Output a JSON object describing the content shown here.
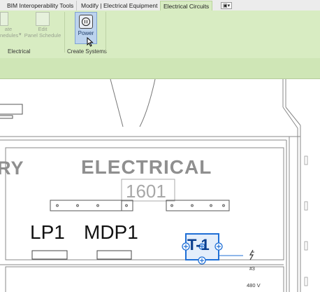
{
  "ribbon": {
    "tabs": [
      {
        "label": "BIM Interoperability Tools"
      },
      {
        "label": "Modify | Electrical Equipment"
      },
      {
        "label": "Electrical Circuits"
      }
    ],
    "tab_drop_glyph": "▣▾",
    "buttons": {
      "create_label_top": "ate",
      "create_label_bottom": "nedules",
      "edit_label_top": "Edit",
      "edit_label_bottom": "Panel Schedule",
      "power_label": "Power"
    },
    "groups": {
      "electrical": "Electrical",
      "create_systems": "Create Systems"
    }
  },
  "plan": {
    "room_name": "ELECTRICAL",
    "room_number": "1601",
    "adjacent_room_partial": "RY",
    "panels": [
      "LP1",
      "MDP1"
    ],
    "transformer_tag": "T-1",
    "circuit_number": "#3",
    "voltage": "480 V"
  },
  "colors": {
    "ribbon_bg": "#d8ecc2",
    "selection_blue": "#1f6fd6",
    "room_text_gray": "#8f8f8f"
  }
}
